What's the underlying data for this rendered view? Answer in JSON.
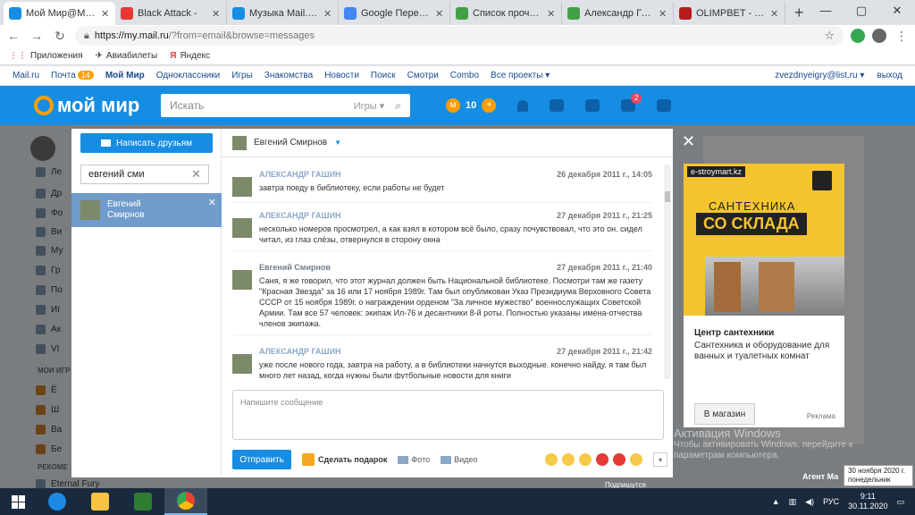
{
  "browser": {
    "tabs": [
      {
        "title": "Мой Мир@Mail.Ru",
        "color": "#168de2",
        "active": true
      },
      {
        "title": "Black Attack - ",
        "color": "#e53935",
        "active": false
      },
      {
        "title": "Музыка Mail.Ru - с",
        "color": "#168de2",
        "active": false
      },
      {
        "title": "Google Переводч",
        "color": "#4285f4",
        "active": false
      },
      {
        "title": "Список прочтений",
        "color": "#43a047",
        "active": false
      },
      {
        "title": "Александр Гашин",
        "color": "#43a047",
        "active": false
      },
      {
        "title": "OLIMPBET - Букмек",
        "color": "#b71c1c",
        "active": false
      }
    ],
    "url_host": "https://my.mail.ru",
    "url_rest": "/?from=email&browse=messages",
    "bookmarks": [
      "Приложения",
      "Авиабилеты",
      "Яндекс"
    ]
  },
  "portal": {
    "left": [
      "Mail.ru",
      "Почта",
      "Мой Мир",
      "Одноклассники",
      "Игры",
      "Знакомства",
      "Новости",
      "Поиск",
      "Смотри",
      "Combo",
      "Все проекты ▾"
    ],
    "mail_count": "14",
    "user_email": "zvezdnyeigry@list.ru ▾",
    "logout": "выход"
  },
  "header": {
    "logo": "мой мир",
    "search_placeholder": "Искать",
    "search_category": "Игры ▾",
    "coins": "10",
    "notify_count": "2"
  },
  "sidebar_bg": {
    "items": [
      "Ле",
      "Др",
      "Фо",
      "Ви",
      "Му",
      "Гр",
      "По",
      "Иг",
      "Ак",
      "VI"
    ],
    "section1": "МОИ ИГР",
    "games": [
      "Ё",
      "Ш",
      "Ва",
      "Бе"
    ],
    "section2": "РЕКОМЕ",
    "bottom_game": "Eternal Fury"
  },
  "messenger": {
    "invite_label": "Написать друзьям",
    "filter_value": "евгений сми",
    "contact_name": "Евгений Смирнов",
    "chat_with": "Евгений Смирнов",
    "messages": [
      {
        "author": "АЛЕКСАНДР ГАШИН",
        "time": "26 декабря 2011 г., 14:05",
        "text": "завтра поеду в библиотеку, если работы не будет"
      },
      {
        "author": "АЛЕКСАНДР ГАШИН",
        "time": "27 декабря 2011 г., 21:25",
        "text": "несколько номеров просмотрел, а как взял в котором всё было, сразу почувствовал, что это он. сидел читал, из глаз слёзы, отвернулся в сторону окна"
      },
      {
        "author": "Евгений Смирнов",
        "time": "27 декабря 2011 г., 21:40",
        "text": "Саня, я же говорил, что этот журнал должен быть Национальной библиотеке. Посмотри там же газету \"Красная Звезда\" за 16 или 17 ноября 1989г. Там был опубликован Указ Президиума Верховного Совета СССР от 15 ноября 1989г. о награждении орденом \"За личное мужество\" военнослужащих Советской Армии. Там все 57 человек: экипаж Ил-76 и десантники 8-й роты. Полностью указаны имена-отчества членов экипажа."
      },
      {
        "author": "АЛЕКСАНДР ГАШИН",
        "time": "27 декабря 2011 г., 21:42",
        "text": "уже после нового года, завтра на работу, а в библиотеки начнутся выходные. конечно найду. я там был много лет назад, когда нужны были футбольные новости для книги"
      }
    ],
    "composer_placeholder": "Напишите сообщение",
    "send_label": "Отправить",
    "gift_label": "Сделать подарок",
    "photo_label": "Фото",
    "video_label": "Видео",
    "emoji_colors": [
      "#f7c948",
      "#f7c948",
      "#f7c948",
      "#e53935",
      "#e53935",
      "#f7c948"
    ]
  },
  "ad": {
    "site": "e-stroymart.kz",
    "headline1": "САНТЕХНИКА",
    "headline2": "СО СКЛАДА",
    "title": "Центр сантехники",
    "description": "Сантехника и оборудование для ванных и туалетных комнат",
    "button": "В магазин",
    "label": "Реклама"
  },
  "watermark": {
    "line1": "Активация Windows",
    "line2": "Чтобы активировать Windows, перейдите к",
    "line3": "параметрам компьютера."
  },
  "tooltip": {
    "line1": "30 ноября 2020 г.",
    "line2": "понедельник"
  },
  "bg_labels": {
    "agent": "Агент Ма",
    "podpiska": "Подпишутся"
  },
  "taskbar": {
    "lang": "РУС",
    "time": "9:11",
    "date": "30.11.2020"
  }
}
